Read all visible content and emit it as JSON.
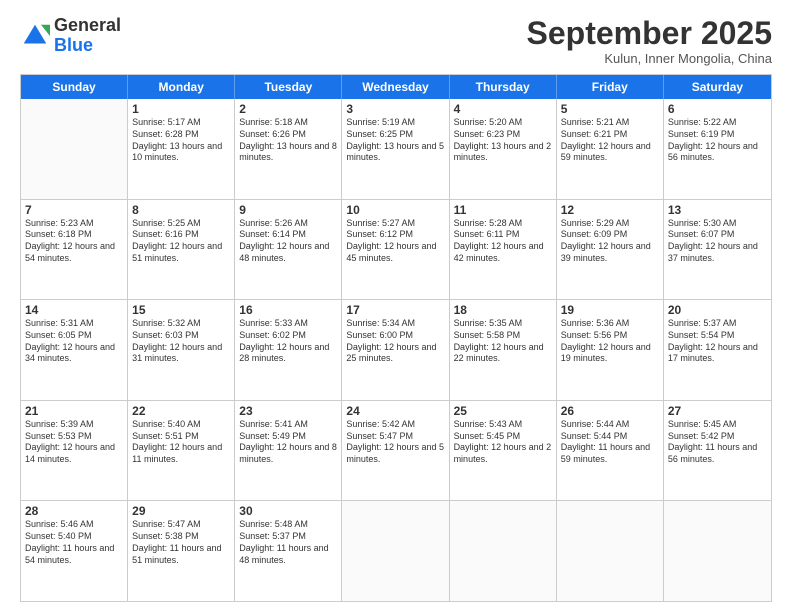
{
  "header": {
    "logo_general": "General",
    "logo_blue": "Blue",
    "month_title": "September 2025",
    "subtitle": "Kulun, Inner Mongolia, China"
  },
  "calendar": {
    "days_of_week": [
      "Sunday",
      "Monday",
      "Tuesday",
      "Wednesday",
      "Thursday",
      "Friday",
      "Saturday"
    ],
    "weeks": [
      [
        {
          "day": "",
          "sunrise": "",
          "sunset": "",
          "daylight": ""
        },
        {
          "day": "1",
          "sunrise": "Sunrise: 5:17 AM",
          "sunset": "Sunset: 6:28 PM",
          "daylight": "Daylight: 13 hours and 10 minutes."
        },
        {
          "day": "2",
          "sunrise": "Sunrise: 5:18 AM",
          "sunset": "Sunset: 6:26 PM",
          "daylight": "Daylight: 13 hours and 8 minutes."
        },
        {
          "day": "3",
          "sunrise": "Sunrise: 5:19 AM",
          "sunset": "Sunset: 6:25 PM",
          "daylight": "Daylight: 13 hours and 5 minutes."
        },
        {
          "day": "4",
          "sunrise": "Sunrise: 5:20 AM",
          "sunset": "Sunset: 6:23 PM",
          "daylight": "Daylight: 13 hours and 2 minutes."
        },
        {
          "day": "5",
          "sunrise": "Sunrise: 5:21 AM",
          "sunset": "Sunset: 6:21 PM",
          "daylight": "Daylight: 12 hours and 59 minutes."
        },
        {
          "day": "6",
          "sunrise": "Sunrise: 5:22 AM",
          "sunset": "Sunset: 6:19 PM",
          "daylight": "Daylight: 12 hours and 56 minutes."
        }
      ],
      [
        {
          "day": "7",
          "sunrise": "Sunrise: 5:23 AM",
          "sunset": "Sunset: 6:18 PM",
          "daylight": "Daylight: 12 hours and 54 minutes."
        },
        {
          "day": "8",
          "sunrise": "Sunrise: 5:25 AM",
          "sunset": "Sunset: 6:16 PM",
          "daylight": "Daylight: 12 hours and 51 minutes."
        },
        {
          "day": "9",
          "sunrise": "Sunrise: 5:26 AM",
          "sunset": "Sunset: 6:14 PM",
          "daylight": "Daylight: 12 hours and 48 minutes."
        },
        {
          "day": "10",
          "sunrise": "Sunrise: 5:27 AM",
          "sunset": "Sunset: 6:12 PM",
          "daylight": "Daylight: 12 hours and 45 minutes."
        },
        {
          "day": "11",
          "sunrise": "Sunrise: 5:28 AM",
          "sunset": "Sunset: 6:11 PM",
          "daylight": "Daylight: 12 hours and 42 minutes."
        },
        {
          "day": "12",
          "sunrise": "Sunrise: 5:29 AM",
          "sunset": "Sunset: 6:09 PM",
          "daylight": "Daylight: 12 hours and 39 minutes."
        },
        {
          "day": "13",
          "sunrise": "Sunrise: 5:30 AM",
          "sunset": "Sunset: 6:07 PM",
          "daylight": "Daylight: 12 hours and 37 minutes."
        }
      ],
      [
        {
          "day": "14",
          "sunrise": "Sunrise: 5:31 AM",
          "sunset": "Sunset: 6:05 PM",
          "daylight": "Daylight: 12 hours and 34 minutes."
        },
        {
          "day": "15",
          "sunrise": "Sunrise: 5:32 AM",
          "sunset": "Sunset: 6:03 PM",
          "daylight": "Daylight: 12 hours and 31 minutes."
        },
        {
          "day": "16",
          "sunrise": "Sunrise: 5:33 AM",
          "sunset": "Sunset: 6:02 PM",
          "daylight": "Daylight: 12 hours and 28 minutes."
        },
        {
          "day": "17",
          "sunrise": "Sunrise: 5:34 AM",
          "sunset": "Sunset: 6:00 PM",
          "daylight": "Daylight: 12 hours and 25 minutes."
        },
        {
          "day": "18",
          "sunrise": "Sunrise: 5:35 AM",
          "sunset": "Sunset: 5:58 PM",
          "daylight": "Daylight: 12 hours and 22 minutes."
        },
        {
          "day": "19",
          "sunrise": "Sunrise: 5:36 AM",
          "sunset": "Sunset: 5:56 PM",
          "daylight": "Daylight: 12 hours and 19 minutes."
        },
        {
          "day": "20",
          "sunrise": "Sunrise: 5:37 AM",
          "sunset": "Sunset: 5:54 PM",
          "daylight": "Daylight: 12 hours and 17 minutes."
        }
      ],
      [
        {
          "day": "21",
          "sunrise": "Sunrise: 5:39 AM",
          "sunset": "Sunset: 5:53 PM",
          "daylight": "Daylight: 12 hours and 14 minutes."
        },
        {
          "day": "22",
          "sunrise": "Sunrise: 5:40 AM",
          "sunset": "Sunset: 5:51 PM",
          "daylight": "Daylight: 12 hours and 11 minutes."
        },
        {
          "day": "23",
          "sunrise": "Sunrise: 5:41 AM",
          "sunset": "Sunset: 5:49 PM",
          "daylight": "Daylight: 12 hours and 8 minutes."
        },
        {
          "day": "24",
          "sunrise": "Sunrise: 5:42 AM",
          "sunset": "Sunset: 5:47 PM",
          "daylight": "Daylight: 12 hours and 5 minutes."
        },
        {
          "day": "25",
          "sunrise": "Sunrise: 5:43 AM",
          "sunset": "Sunset: 5:45 PM",
          "daylight": "Daylight: 12 hours and 2 minutes."
        },
        {
          "day": "26",
          "sunrise": "Sunrise: 5:44 AM",
          "sunset": "Sunset: 5:44 PM",
          "daylight": "Daylight: 11 hours and 59 minutes."
        },
        {
          "day": "27",
          "sunrise": "Sunrise: 5:45 AM",
          "sunset": "Sunset: 5:42 PM",
          "daylight": "Daylight: 11 hours and 56 minutes."
        }
      ],
      [
        {
          "day": "28",
          "sunrise": "Sunrise: 5:46 AM",
          "sunset": "Sunset: 5:40 PM",
          "daylight": "Daylight: 11 hours and 54 minutes."
        },
        {
          "day": "29",
          "sunrise": "Sunrise: 5:47 AM",
          "sunset": "Sunset: 5:38 PM",
          "daylight": "Daylight: 11 hours and 51 minutes."
        },
        {
          "day": "30",
          "sunrise": "Sunrise: 5:48 AM",
          "sunset": "Sunset: 5:37 PM",
          "daylight": "Daylight: 11 hours and 48 minutes."
        },
        {
          "day": "",
          "sunrise": "",
          "sunset": "",
          "daylight": ""
        },
        {
          "day": "",
          "sunrise": "",
          "sunset": "",
          "daylight": ""
        },
        {
          "day": "",
          "sunrise": "",
          "sunset": "",
          "daylight": ""
        },
        {
          "day": "",
          "sunrise": "",
          "sunset": "",
          "daylight": ""
        }
      ]
    ]
  }
}
